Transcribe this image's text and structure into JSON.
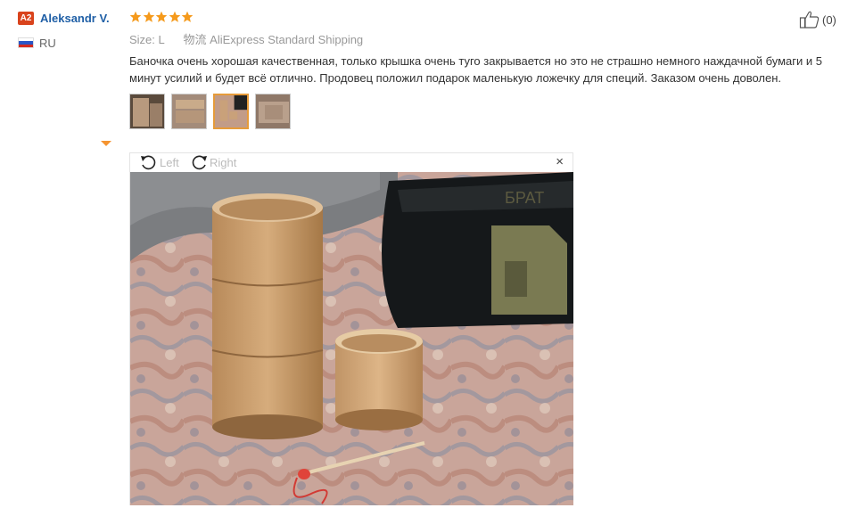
{
  "user": {
    "level": "A2",
    "name": "Aleksandr V.",
    "country": "RU"
  },
  "review": {
    "rating": 5,
    "size_label": "Size:",
    "size_value": "L",
    "shipping_label": "物流",
    "shipping_value": "AliExpress Standard Shipping",
    "text": "Баночка очень хорошая качественная, только крышка очень туго закрывается но это не страшно немного наждачной бумаги и 5 минут усилий и будет всё отлично. Продовец положил подарок маленькую ложечку для специй. Заказом очень доволен."
  },
  "viewer": {
    "rotate_left": "Left",
    "rotate_right": "Right",
    "close": "×"
  },
  "helpful": {
    "count": "(0)"
  },
  "colors": {
    "star": "#f59a1c",
    "level_badge": "#d9431c",
    "name": "#1f5fa6",
    "thumb_active_border": "#e69b3a"
  }
}
